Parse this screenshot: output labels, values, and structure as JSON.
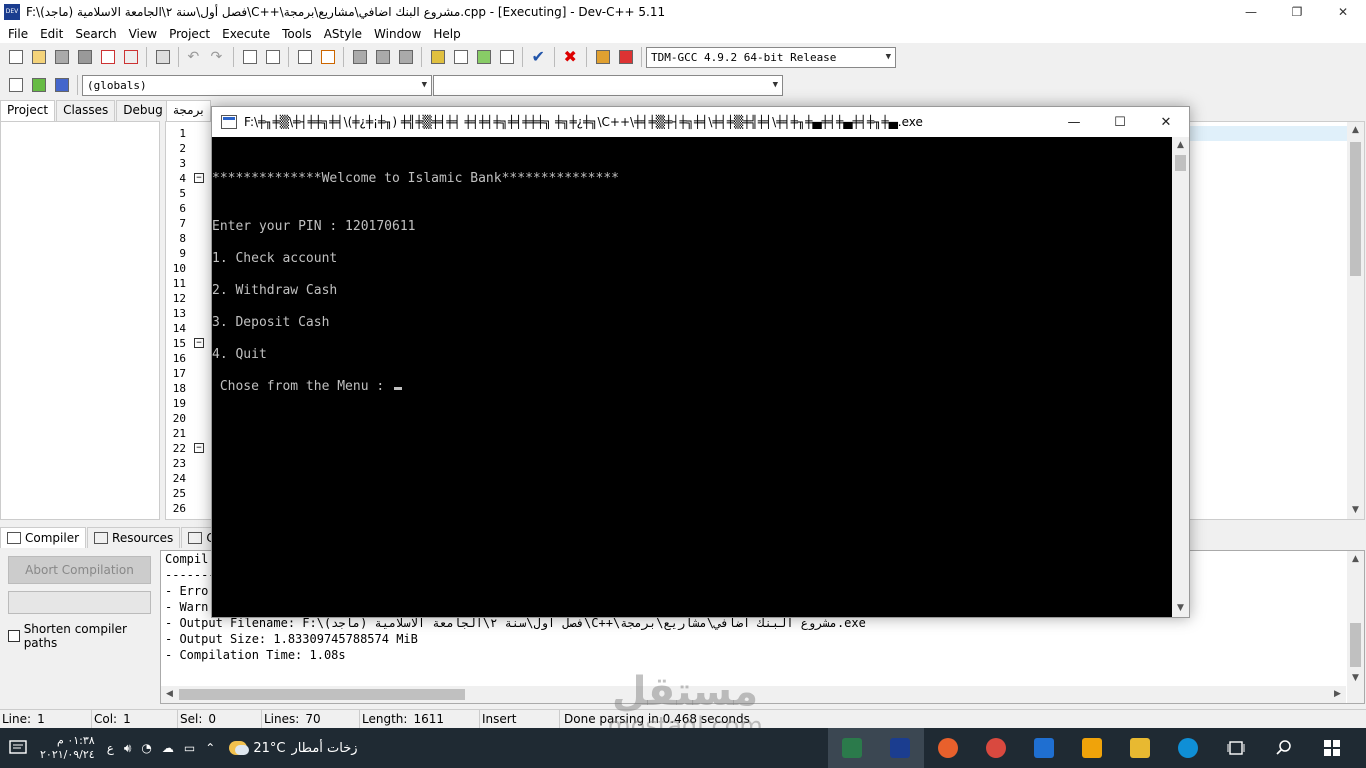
{
  "window": {
    "title": "F:\\فصل أول\\سنة ٢\\الجامعة الاسلامية (ماجد)\\C++\\مشروع البنك اضافي\\مشاريع\\برمجة.cpp - [Executing] - Dev-C++ 5.11",
    "icon_text": "DEV",
    "controls": {
      "minimize": "—",
      "restore": "❐",
      "close": "✕"
    }
  },
  "menu": [
    "File",
    "Edit",
    "Search",
    "View",
    "Project",
    "Execute",
    "Tools",
    "AStyle",
    "Window",
    "Help"
  ],
  "toolbar": {
    "compiler_select": "TDM-GCC 4.9.2 64-bit Release",
    "scope_select": "(globals)",
    "member_select": ""
  },
  "left_tabs": [
    "Project",
    "Classes",
    "Debug"
  ],
  "editor": {
    "tab_label": "برمجة",
    "line_numbers": [
      "1",
      "2",
      "3",
      "4",
      "5",
      "6",
      "7",
      "8",
      "9",
      "10",
      "11",
      "12",
      "13",
      "14",
      "15",
      "16",
      "17",
      "18",
      "19",
      "20",
      "21",
      "22",
      "23",
      "24",
      "25",
      "26"
    ],
    "fold_lines": [
      "4",
      "15",
      "22"
    ]
  },
  "bottom_tabs": [
    "Compiler",
    "Resources",
    "Co"
  ],
  "compiler_panel": {
    "abort_label": "Abort Compilation",
    "shorten_label": "Shorten compiler paths",
    "log": [
      "Compil",
      "-------",
      "- Erro",
      "- Warn",
      "- Output Filename: F:\\فصل أول\\سنة ٢\\الجامعة الاسلامية (ماجد)\\C++\\مشروع البنك اضافي\\مشاريع\\برمجة.exe",
      "- Output Size: 1.83309745788574 MiB",
      "- Compilation Time: 1.08s"
    ]
  },
  "statusbar": {
    "line_label": "Line:",
    "line_value": "1",
    "col_label": "Col:",
    "col_value": "1",
    "sel_label": "Sel:",
    "sel_value": "0",
    "lines_label": "Lines:",
    "lines_value": "70",
    "length_label": "Length:",
    "length_value": "1611",
    "mode": "Insert",
    "message": "Done parsing in 0.468 seconds"
  },
  "console": {
    "title": "F:\\╪╖╪▒\\╪┤╪╪╗╪╡\\(╪¿╪¡╪╖) ╪╣╪▒╪╡╪╡ ╪╡╪╡╪╗╪╡╪╪╪╗ ╪╗╪¿╪╗\\C++\\╪╡╪▒╪┤╪╗╪╡\\╪╡╪▒╪╣╪╡\\╪╡╪╖╪▄╪╡╪▄╪╡╪╖╪▄.exe",
    "lines": [
      "**************Welcome to Islamic Bank***************",
      "Enter your PIN : 120170611",
      "1. Check account",
      "2. Withdraw Cash",
      "3. Deposit Cash",
      "4. Quit",
      " Chose from the Menu : "
    ]
  },
  "watermark": {
    "arabic": "مستقل",
    "latin": "mostaql.com"
  },
  "taskbar": {
    "time": "٠١:٣٨ م",
    "date": "٢٠٢١/٠٩/٢٤",
    "lang": "ع",
    "temperature": "21°C",
    "weather": "زخات أمطار",
    "app_colors": [
      "#2b7a4b",
      "#1b3d8f",
      "#e8602c",
      "#d9493f",
      "#1f6fd1",
      "#f0a30a",
      "#e8b931",
      "#0f8fd6"
    ]
  },
  "colors": {
    "console_bg": "#000000",
    "console_text": "#c0c0c0",
    "taskbar_bg": "#1f2a33",
    "current_line": "#e0f0fa"
  }
}
